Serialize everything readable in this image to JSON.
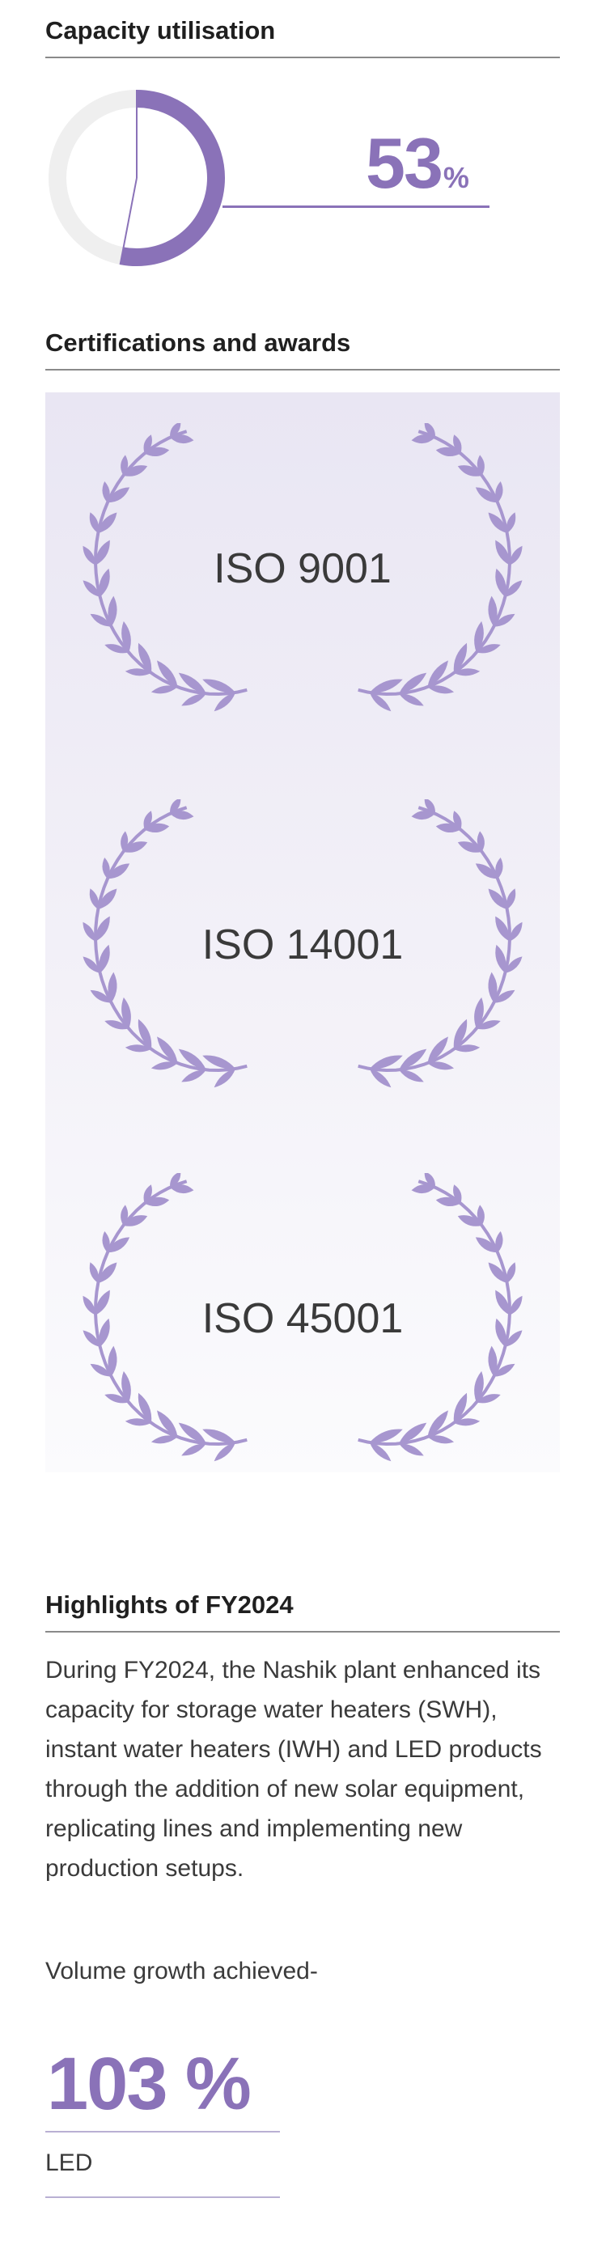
{
  "capacity": {
    "title": "Capacity utilisation",
    "value": "53",
    "unit": "%",
    "fraction": 0.53,
    "colors": {
      "accent": "#8a72b8",
      "track": "#efefef"
    }
  },
  "certifications": {
    "title": "Certifications and awards",
    "items": [
      {
        "label": "ISO 9001",
        "icon": "laurel-wreath-icon"
      },
      {
        "label": "ISO 14001",
        "icon": "laurel-wreath-icon"
      },
      {
        "label": "ISO 45001",
        "icon": "laurel-wreath-icon"
      }
    ],
    "colors": {
      "wreath": "#a796cf"
    }
  },
  "highlights": {
    "title": "Highlights of FY2024",
    "body": "During FY2024, the Nashik plant enhanced its capacity for storage water heaters (SWH), instant water heaters (IWH) and LED products through the addition of new solar equipment, replicating lines and implementing new production setups.",
    "growth_intro": "Volume growth achieved-",
    "metric": {
      "value": "103 %",
      "label": "LED"
    }
  }
}
